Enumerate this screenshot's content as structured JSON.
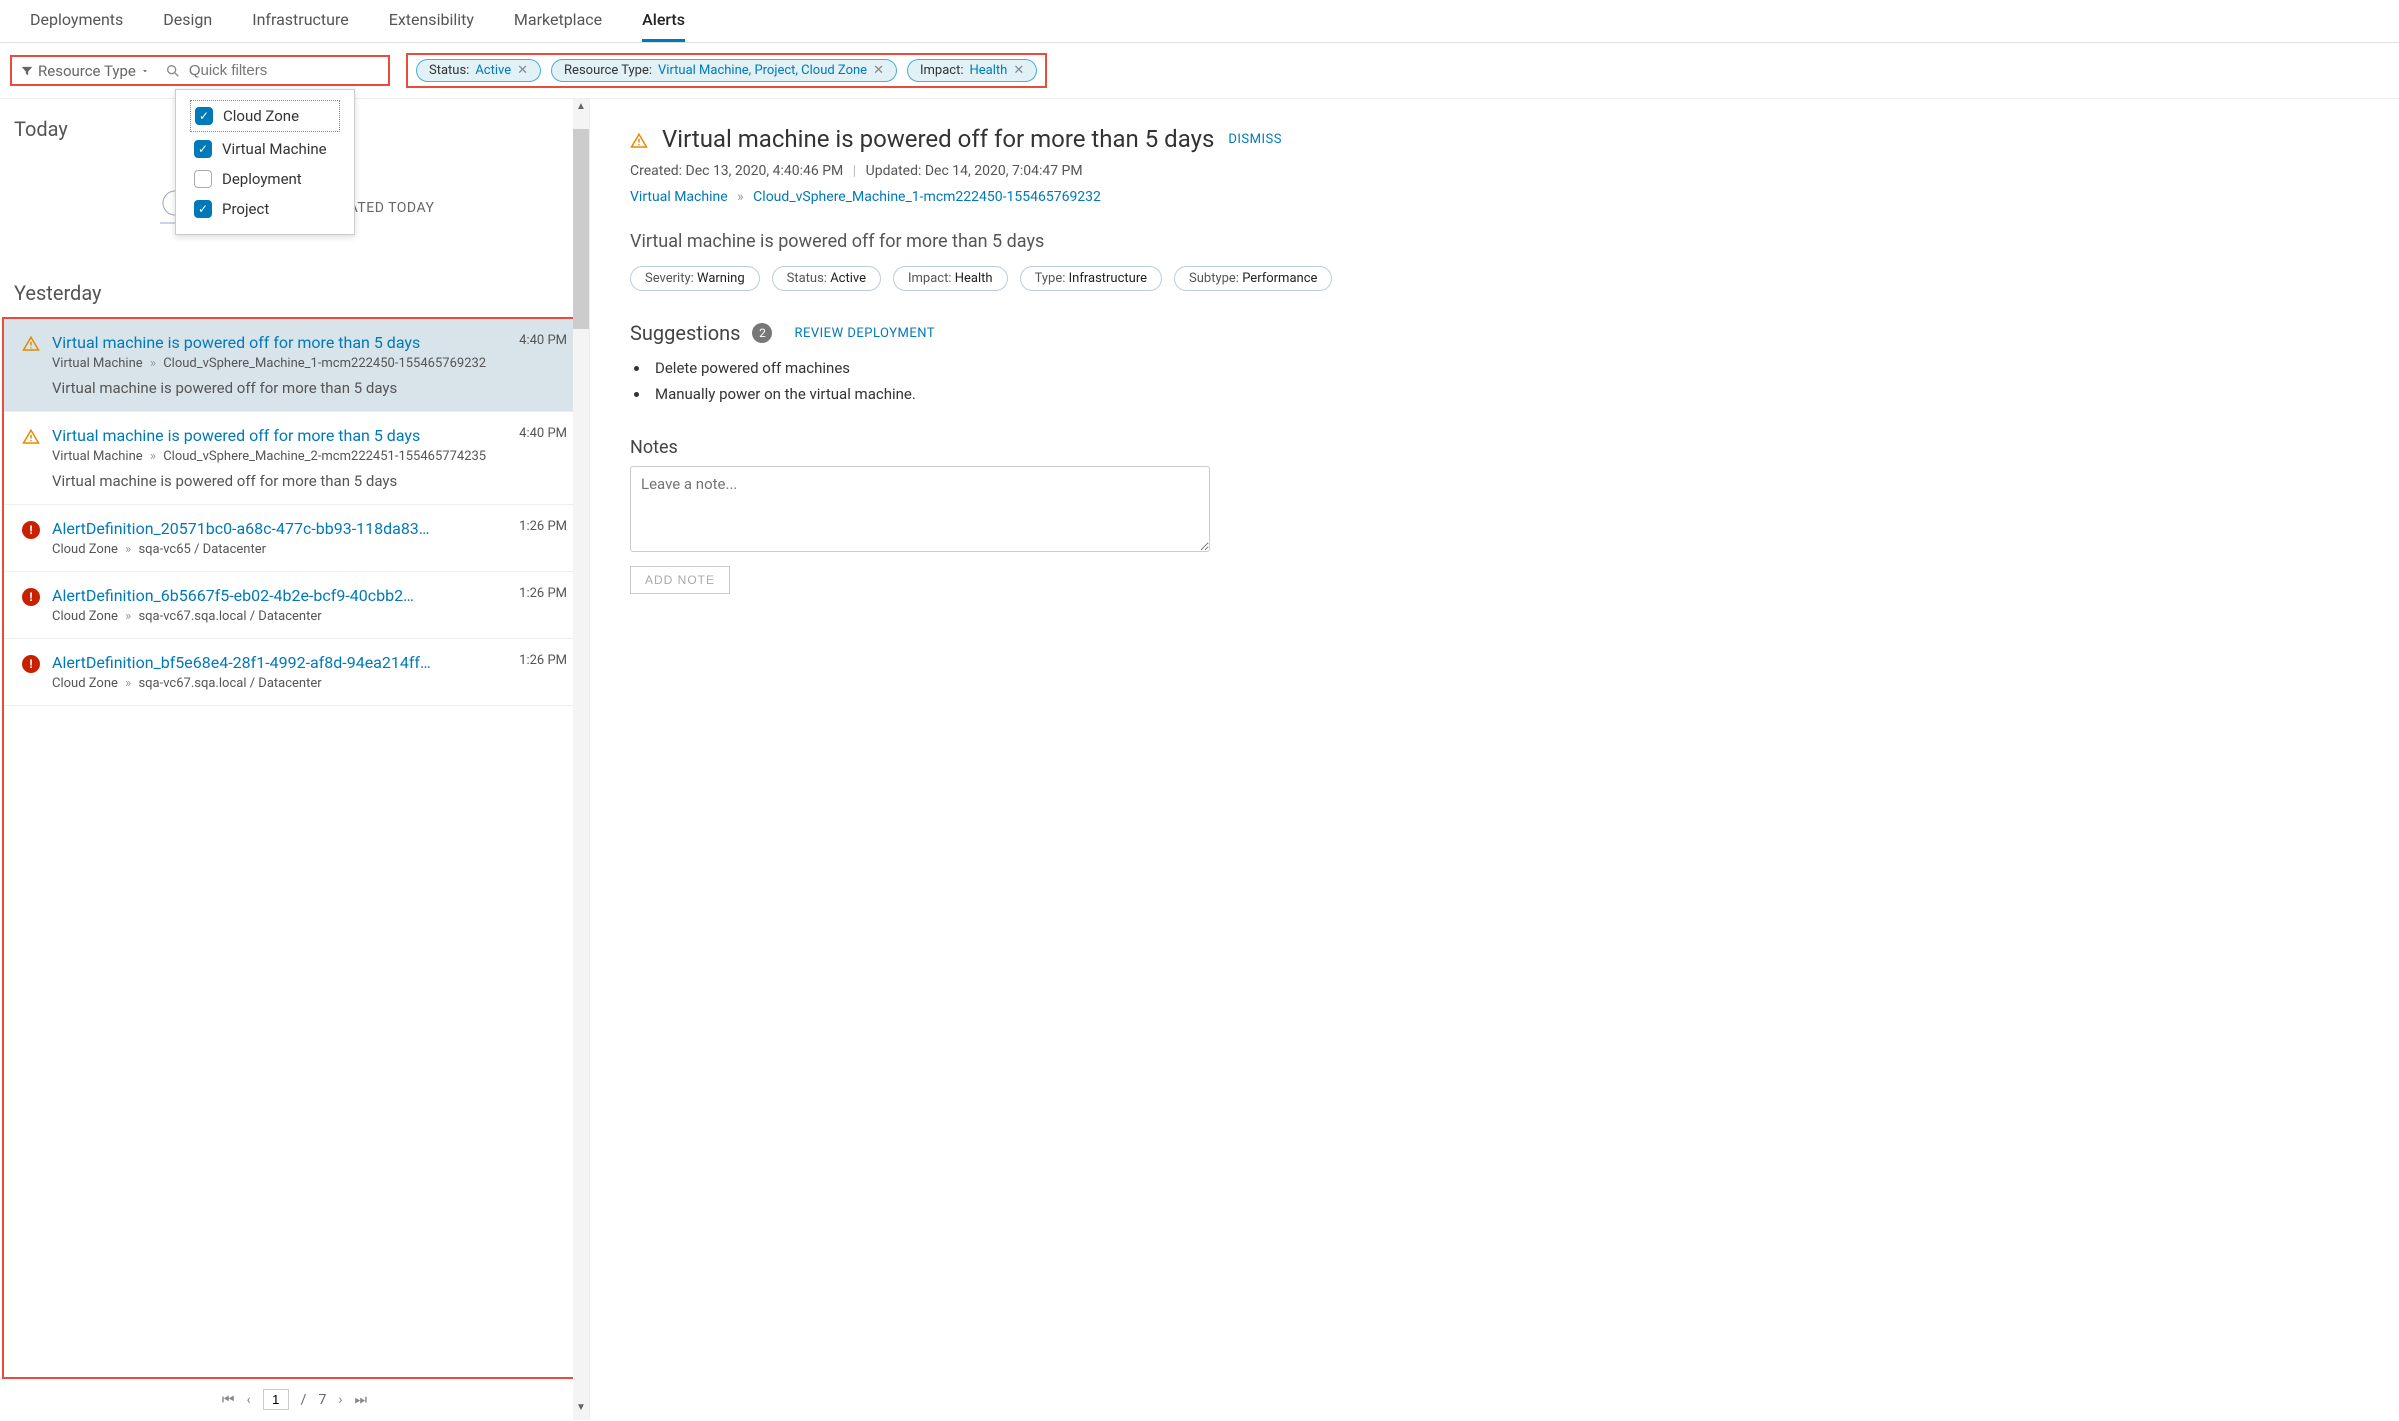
{
  "tabs": [
    "Deployments",
    "Design",
    "Infrastructure",
    "Extensibility",
    "Marketplace",
    "Alerts"
  ],
  "active_tab": "Alerts",
  "filter": {
    "resource_label": "Resource Type",
    "quick_placeholder": "Quick filters",
    "options": [
      {
        "label": "Cloud Zone",
        "checked": true
      },
      {
        "label": "Virtual Machine",
        "checked": true
      },
      {
        "label": "Deployment",
        "checked": false
      },
      {
        "label": "Project",
        "checked": true
      }
    ]
  },
  "chips": [
    {
      "label": "Status:",
      "value": "Active"
    },
    {
      "label": "Resource Type:",
      "value": "Virtual Machine, Project, Cloud Zone"
    },
    {
      "label": "Impact:",
      "value": "Health"
    }
  ],
  "sections": {
    "today": "Today",
    "today_empty": "NO ALERTS CREATED TODAY",
    "yesterday": "Yesterday"
  },
  "alerts": [
    {
      "severity": "warning",
      "title": "Virtual machine is powered off for more than 5 days",
      "time": "4:40 PM",
      "path_type": "Virtual Machine",
      "path_name": "Cloud_vSphere_Machine_1-mcm222450-155465769232",
      "desc": "Virtual machine is powered off for more than 5 days",
      "selected": true
    },
    {
      "severity": "warning",
      "title": "Virtual machine is powered off for more than 5 days",
      "time": "4:40 PM",
      "path_type": "Virtual Machine",
      "path_name": "Cloud_vSphere_Machine_2-mcm222451-155465774235",
      "desc": "Virtual machine is powered off for more than 5 days",
      "selected": false
    },
    {
      "severity": "critical",
      "title": "AlertDefinition_20571bc0-a68c-477c-bb93-118da83…",
      "time": "1:26 PM",
      "path_type": "Cloud Zone",
      "path_name": "sqa-vc65 / Datacenter",
      "desc": "",
      "selected": false
    },
    {
      "severity": "critical",
      "title": "AlertDefinition_6b5667f5-eb02-4b2e-bcf9-40cbb2…",
      "time": "1:26 PM",
      "path_type": "Cloud Zone",
      "path_name": "sqa-vc67.sqa.local / Datacenter",
      "desc": "",
      "selected": false
    },
    {
      "severity": "critical",
      "title": "AlertDefinition_bf5e68e4-28f1-4992-af8d-94ea214ff…",
      "time": "1:26 PM",
      "path_type": "Cloud Zone",
      "path_name": "sqa-vc67.sqa.local / Datacenter",
      "desc": "",
      "selected": false
    }
  ],
  "pager": {
    "current": "1",
    "total": "7"
  },
  "detail": {
    "title": "Virtual machine is powered off for more than 5 days",
    "dismiss": "DISMISS",
    "created": "Created: Dec 13, 2020, 4:40:46 PM",
    "updated": "Updated: Dec 14, 2020, 7:04:47 PM",
    "bc_type": "Virtual Machine",
    "bc_name": "Cloud_vSphere_Machine_1-mcm222450-155465769232",
    "subtitle": "Virtual machine is powered off for more than 5 days",
    "pills": [
      {
        "label": "Severity:",
        "value": "Warning"
      },
      {
        "label": "Status:",
        "value": "Active"
      },
      {
        "label": "Impact:",
        "value": "Health"
      },
      {
        "label": "Type:",
        "value": "Infrastructure"
      },
      {
        "label": "Subtype:",
        "value": "Performance"
      }
    ],
    "suggestions_label": "Suggestions",
    "suggestions_count": "2",
    "review": "REVIEW DEPLOYMENT",
    "suggestions": [
      "Delete powered off machines",
      "Manually power on the virtual machine."
    ],
    "notes_label": "Notes",
    "notes_placeholder": "Leave a note...",
    "add_note": "ADD NOTE"
  }
}
